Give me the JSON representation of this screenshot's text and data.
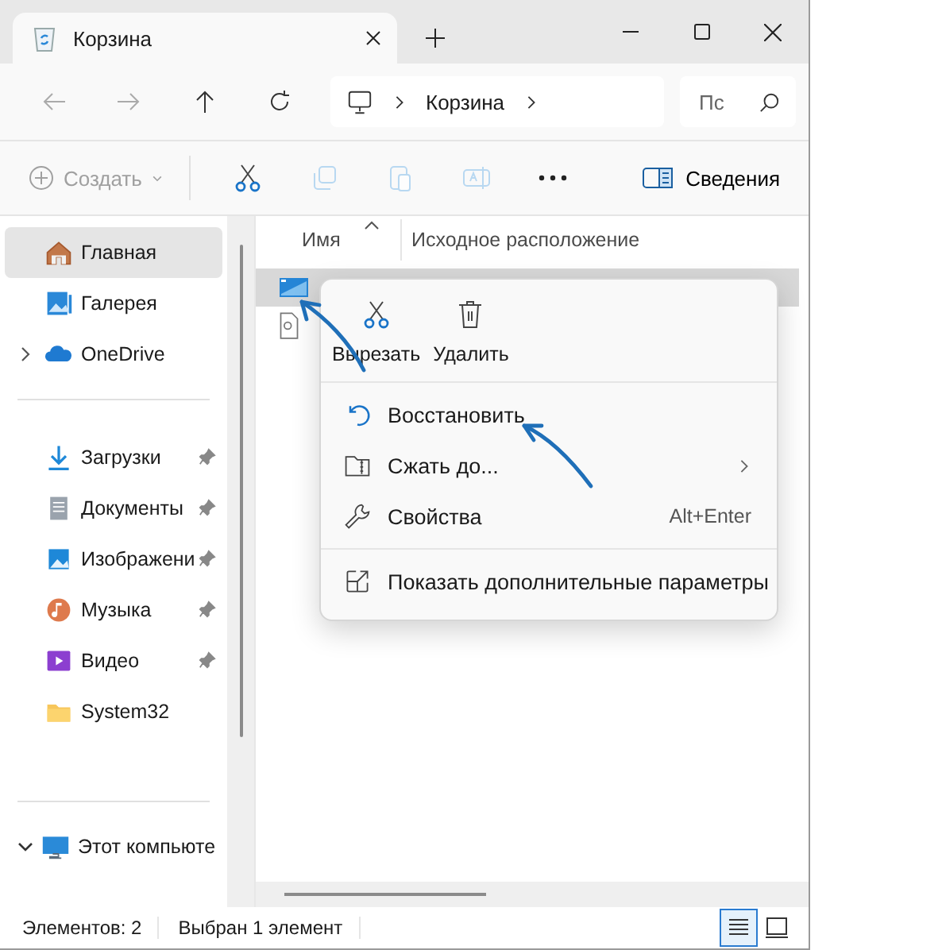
{
  "tab": {
    "title": "Корзина"
  },
  "address": {
    "segments": [
      "Корзина"
    ]
  },
  "search": {
    "placeholder": "Пс"
  },
  "commands": {
    "create": {
      "label": "Создать",
      "disabled": true
    },
    "tools": [
      {
        "kind": "cut",
        "disabled": false
      },
      {
        "kind": "copy",
        "disabled": true
      },
      {
        "kind": "paste",
        "disabled": true
      },
      {
        "kind": "rename",
        "disabled": true
      },
      {
        "kind": "more",
        "disabled": false
      }
    ],
    "details": "Сведения"
  },
  "sidebar": {
    "groups": [
      [
        {
          "label": "Главная",
          "kind": "home",
          "selected": true,
          "pinned": false
        },
        {
          "label": "Галерея",
          "kind": "gallery",
          "selected": false,
          "pinned": false
        },
        {
          "label": "OneDrive",
          "kind": "cloud",
          "selected": false,
          "pinned": false,
          "expanded": false
        }
      ],
      [
        {
          "label": "Загрузки",
          "kind": "download",
          "selected": false,
          "pinned": true
        },
        {
          "label": "Документы",
          "kind": "documents",
          "selected": false,
          "pinned": true
        },
        {
          "label": "Изображени",
          "kind": "pictures",
          "selected": false,
          "pinned": true
        },
        {
          "label": "Музыка",
          "kind": "music",
          "selected": false,
          "pinned": true
        },
        {
          "label": "Видео",
          "kind": "video",
          "selected": false,
          "pinned": true
        },
        {
          "label": "System32",
          "kind": "folder",
          "selected": false,
          "pinned": false
        }
      ],
      [
        {
          "label": "Этот компьюте",
          "kind": "computer",
          "selected": false,
          "pinned": false,
          "expanded": true
        }
      ]
    ]
  },
  "file_list": {
    "columns": [
      "Имя",
      "Исходное расположение"
    ],
    "rows": [
      {
        "kind": "image",
        "selected": true
      },
      {
        "kind": "file",
        "selected": false
      }
    ]
  },
  "context_menu": {
    "quick_actions": [
      {
        "label": "Вырезать",
        "kind": "cut"
      },
      {
        "label": "Удалить",
        "kind": "delete"
      }
    ],
    "groups": [
      [
        {
          "label": "Восстановить",
          "kind": "restore"
        },
        {
          "label": "Сжать до...",
          "kind": "zip",
          "submenu": true
        },
        {
          "label": "Свойства",
          "kind": "wrench",
          "shortcut": "Alt+Enter"
        }
      ],
      [
        {
          "label": "Показать дополнительные параметры",
          "kind": "expand"
        }
      ]
    ]
  },
  "status_bar": {
    "items": [
      "Элементов: 2",
      "Выбран 1 элемент"
    ],
    "views": [
      {
        "kind": "details",
        "selected": true
      },
      {
        "kind": "tiles",
        "selected": false
      }
    ]
  },
  "annotations": [
    {
      "kind": "arrow"
    },
    {
      "kind": "arrow"
    }
  ]
}
